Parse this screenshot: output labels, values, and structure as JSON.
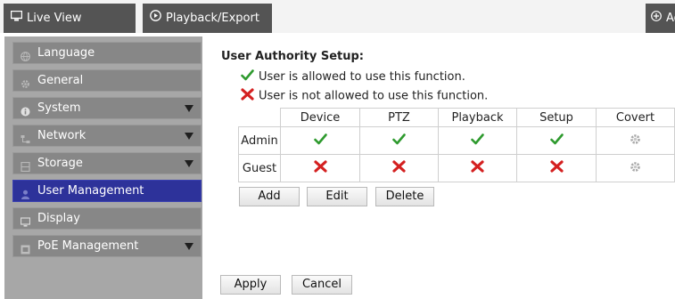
{
  "topbar": {
    "tabs": [
      {
        "label": "Live View",
        "icon": "monitor-icon"
      },
      {
        "label": "Playback/Export",
        "icon": "play-circle-icon"
      },
      {
        "label": "Ad",
        "icon": "plus-circle-icon"
      }
    ]
  },
  "sidebar": {
    "items": [
      {
        "label": "Language",
        "icon": "globe-icon",
        "has_submenu": false,
        "active": false
      },
      {
        "label": "General",
        "icon": "gear-icon",
        "has_submenu": false,
        "active": false
      },
      {
        "label": "System",
        "icon": "info-icon",
        "has_submenu": true,
        "active": false
      },
      {
        "label": "Network",
        "icon": "network-icon",
        "has_submenu": true,
        "active": false
      },
      {
        "label": "Storage",
        "icon": "storage-icon",
        "has_submenu": true,
        "active": false
      },
      {
        "label": "User Management",
        "icon": "user-icon",
        "has_submenu": false,
        "active": true
      },
      {
        "label": "Display",
        "icon": "monitor-icon",
        "has_submenu": false,
        "active": false
      },
      {
        "label": "PoE Management",
        "icon": "poe-icon",
        "has_submenu": true,
        "active": false
      }
    ]
  },
  "main": {
    "heading": "User Authority Setup:",
    "legend": {
      "allowed": "User is allowed to use this function.",
      "denied": "User is not allowed to use this function."
    },
    "table": {
      "columns": [
        "Device",
        "PTZ",
        "Playback",
        "Setup",
        "Covert"
      ],
      "rows": [
        {
          "user": "Admin",
          "cells": [
            "check",
            "check",
            "check",
            "check",
            "gear"
          ]
        },
        {
          "user": "Guest",
          "cells": [
            "cross",
            "cross",
            "cross",
            "cross",
            "gear"
          ]
        }
      ]
    },
    "buttons": {
      "add": "Add",
      "edit": "Edit",
      "delete": "Delete"
    },
    "footer": {
      "apply": "Apply",
      "cancel": "Cancel"
    }
  },
  "colors": {
    "active_item": "#2d329a",
    "check": "#2e9a2e",
    "cross": "#d42020",
    "tab_bg": "#545454"
  }
}
